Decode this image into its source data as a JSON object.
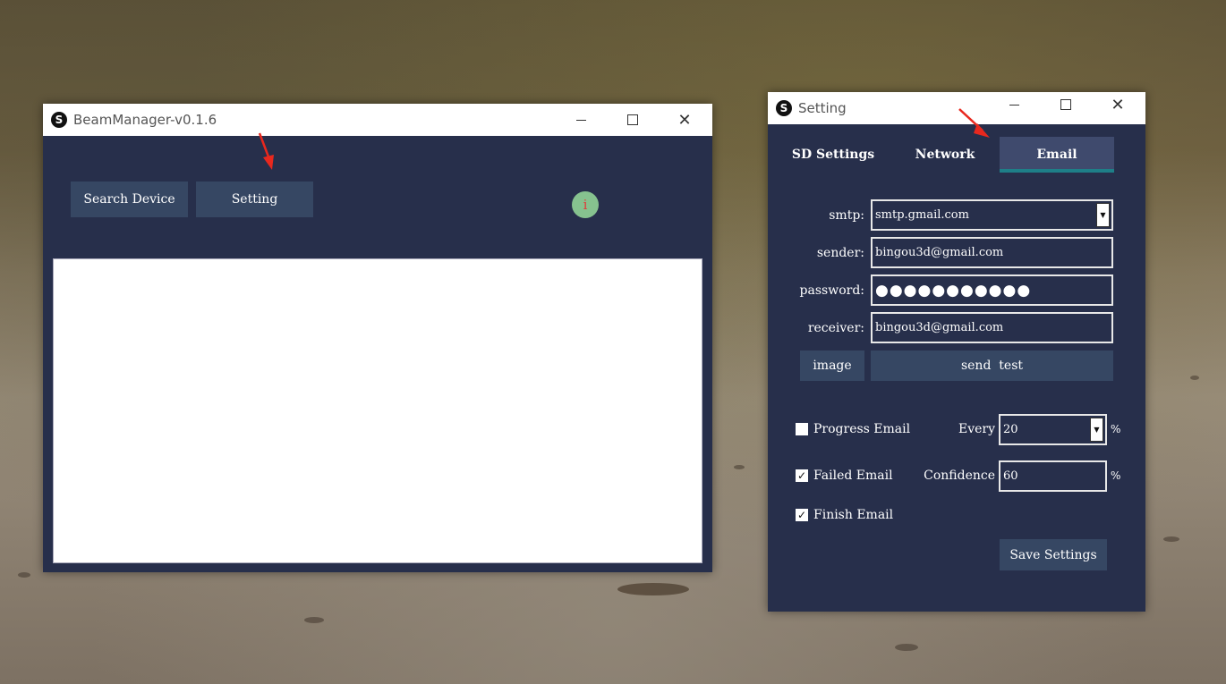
{
  "main_window": {
    "title": "BeamManager-v0.1.6",
    "logo_glyph": "S",
    "search_device_label": "Search Device",
    "setting_label": "Setting",
    "info_glyph": "i"
  },
  "setting_window": {
    "title": "Setting",
    "logo_glyph": "S",
    "tabs": [
      {
        "label": "SD Settings",
        "active": false
      },
      {
        "label": "Network",
        "active": false
      },
      {
        "label": "Email",
        "active": true
      }
    ],
    "smtp_label": "smtp:",
    "smtp_value": "smtp.gmail.com",
    "sender_label": "sender:",
    "sender_value": "bingou3d@gmail.com",
    "password_label": "password:",
    "password_value": "●●●●●●●●●●●",
    "receiver_label": "receiver:",
    "receiver_value": "bingou3d@gmail.com",
    "image_label": "image",
    "send_test_label": "send  test",
    "progress_email_label": "Progress Email",
    "progress_email_checked": false,
    "every_label": "Every",
    "every_value": "20",
    "failed_email_label": "Failed Email",
    "failed_email_checked": true,
    "confidence_label": "Confidence",
    "confidence_value": "60",
    "finish_email_label": "Finish Email",
    "finish_email_checked": true,
    "percent_sign": "%",
    "save_label": "Save Settings"
  },
  "window_controls": {
    "minimize_glyph": "—",
    "maximize_glyph": "☐",
    "close_glyph": "✕"
  },
  "colors": {
    "window_bg": "#272f4b",
    "button_bg": "#364763",
    "active_tab_bg": "#3f4a6d",
    "tab_underline": "#1e7f88",
    "info_circle": "#86c28f",
    "annotation_arrow": "#e8281e"
  }
}
